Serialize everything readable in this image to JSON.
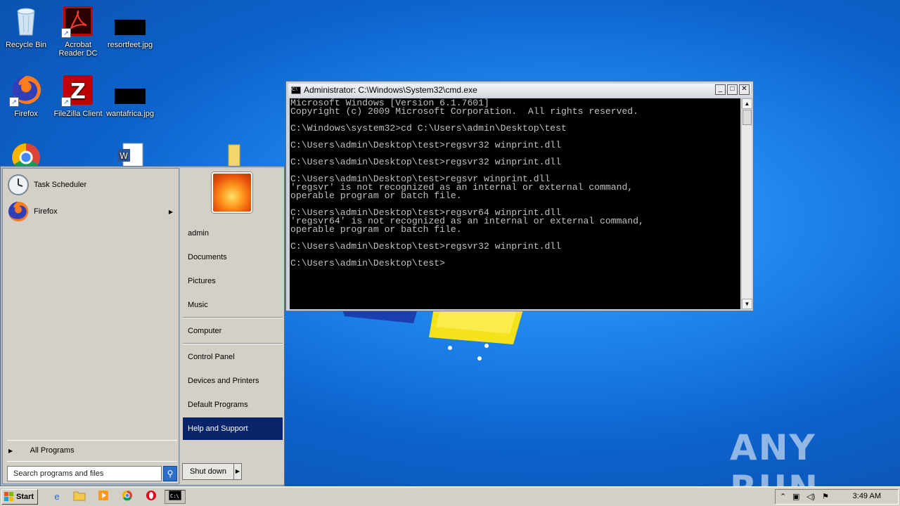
{
  "desktop": {
    "icons": [
      {
        "label": "Recycle Bin",
        "icon": "recycle-bin-icon"
      },
      {
        "label": "Acrobat Reader DC",
        "icon": "acrobat-icon"
      },
      {
        "label": "resortfeet.jpg",
        "icon": "image-file-icon"
      },
      {
        "label": "Firefox",
        "icon": "firefox-icon"
      },
      {
        "label": "FileZilla Client",
        "icon": "filezilla-icon"
      },
      {
        "label": "wantafrica.jpg",
        "icon": "image-file-icon"
      }
    ]
  },
  "cmd": {
    "title": "Administrator: C:\\Windows\\System32\\cmd.exe",
    "lines": [
      "Microsoft Windows [Version 6.1.7601]",
      "Copyright (c) 2009 Microsoft Corporation.  All rights reserved.",
      "",
      "C:\\Windows\\system32>cd C:\\Users\\admin\\Desktop\\test",
      "",
      "C:\\Users\\admin\\Desktop\\test>regsvr32 winprint.dll",
      "",
      "C:\\Users\\admin\\Desktop\\test>regsvr32 winprint.dll",
      "",
      "C:\\Users\\admin\\Desktop\\test>regsvr winprint.dll",
      "'regsvr' is not recognized as an internal or external command,",
      "operable program or batch file.",
      "",
      "C:\\Users\\admin\\Desktop\\test>regsvr64 winprint.dll",
      "'regsvr64' is not recognized as an internal or external command,",
      "operable program or batch file.",
      "",
      "C:\\Users\\admin\\Desktop\\test>regsvr32 winprint.dll",
      "",
      "C:\\Users\\admin\\Desktop\\test>"
    ]
  },
  "startmenu": {
    "programs": [
      {
        "label": "Task Scheduler",
        "icon": "clock-icon"
      },
      {
        "label": "Firefox",
        "icon": "firefox-icon"
      }
    ],
    "all_programs": "All Programs",
    "search_placeholder": "Search programs and files",
    "right_items": [
      "admin",
      "Documents",
      "Pictures",
      "Music",
      "Computer",
      "Control Panel",
      "Devices and Printers",
      "Default Programs",
      "Help and Support"
    ],
    "shutdown": "Shut down"
  },
  "taskbar": {
    "start": "Start",
    "clock": "3:49 AM"
  },
  "watermark": "ANY RUN"
}
